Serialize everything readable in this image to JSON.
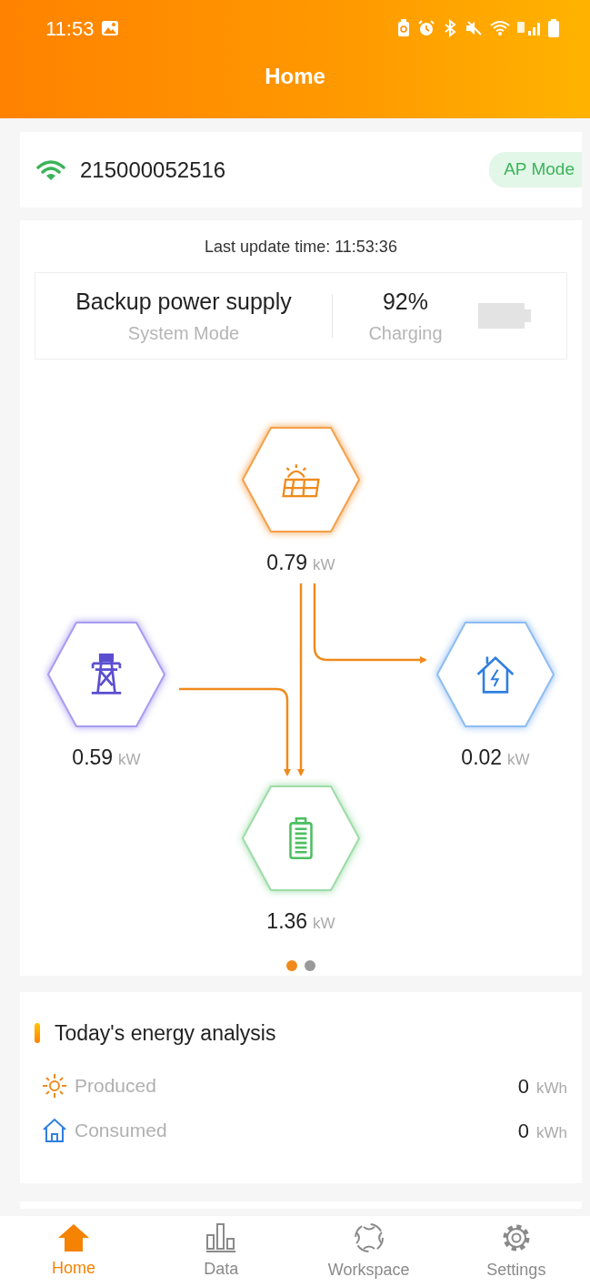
{
  "status_bar": {
    "time": "11:53"
  },
  "header": {
    "title": "Home"
  },
  "device": {
    "serial": "215000052516",
    "connected": true,
    "mode": "AP Mode"
  },
  "overview": {
    "last_update": "Last update time: 11:53:36",
    "system_mode": {
      "value": "Backup power supply",
      "label": "System Mode"
    },
    "battery": {
      "value": "92%",
      "label": "Charging"
    },
    "nodes": [
      {
        "kind": "solar",
        "value": "0.79",
        "unit": "kW"
      },
      {
        "kind": "grid",
        "value": "0.59",
        "unit": "kW"
      },
      {
        "kind": "home",
        "value": "0.02",
        "unit": "kW"
      },
      {
        "kind": "battery",
        "value": "1.36",
        "unit": "kW"
      }
    ],
    "pages": [
      {
        "selected": true
      },
      {
        "selected": false
      }
    ]
  },
  "energy": {
    "title": "Today's energy analysis",
    "rows": [
      {
        "kind": "produced",
        "label": "Produced",
        "value": "0",
        "unit": "kWh"
      },
      {
        "kind": "consumed",
        "label": "Consumed",
        "value": "0",
        "unit": "kWh"
      }
    ]
  },
  "tabs": [
    {
      "kind": "home",
      "label": "Home",
      "selected": true
    },
    {
      "kind": "data",
      "label": "Data",
      "selected": false
    },
    {
      "kind": "workspace",
      "label": "Workspace",
      "selected": false
    },
    {
      "kind": "settings",
      "label": "Settings",
      "selected": false
    }
  ]
}
